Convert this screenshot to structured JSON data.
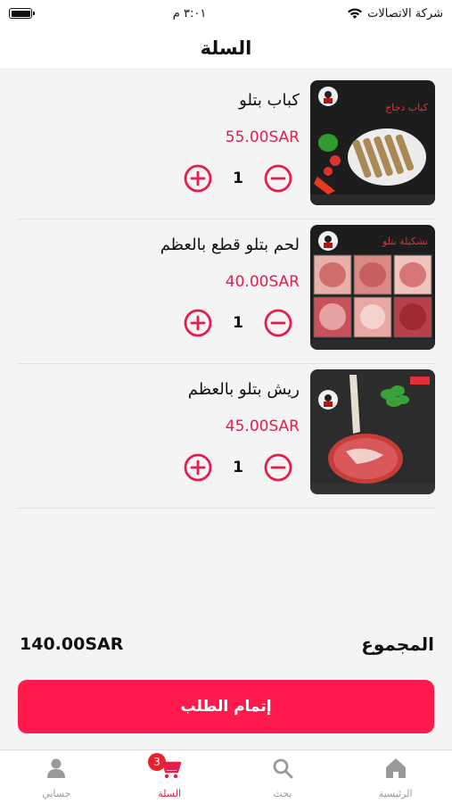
{
  "status_bar": {
    "carrier": "شركة الاتصالات",
    "time": "٣:٠١ م",
    "battery_level": 1.0
  },
  "header": {
    "title": "السلة"
  },
  "cart": {
    "items": [
      {
        "name": "كباب بتلو",
        "price": "55.00SAR",
        "quantity": "1",
        "image_icon": "kebab-photo",
        "image_caption": "كباب دجاج"
      },
      {
        "name": "لحم بتلو قطع بالعظم",
        "price": "40.00SAR",
        "quantity": "1",
        "image_icon": "meat-cuts-photo",
        "image_caption": "تشكيلة بتلو"
      },
      {
        "name": "ريش بتلو بالعظم",
        "price": "45.00SAR",
        "quantity": "1",
        "image_icon": "tomahawk-steak-photo",
        "image_caption": ""
      }
    ]
  },
  "total": {
    "label": "المجموع",
    "amount": "140.00SAR"
  },
  "checkout": {
    "label": "إتمام الطلب"
  },
  "tabbar": {
    "tabs": [
      {
        "label": "حسابي",
        "icon": "user-icon",
        "active": false
      },
      {
        "label": "السلة",
        "icon": "cart-icon",
        "active": true,
        "badge": "3"
      },
      {
        "label": "بحث",
        "icon": "search-icon",
        "active": false
      },
      {
        "label": "الرئيسية",
        "icon": "home-icon",
        "active": false
      }
    ]
  },
  "colors": {
    "accent": "#ff1a4e",
    "price": "#e51d4b",
    "badge": "#e5232e",
    "inactive_tab": "#999999"
  }
}
